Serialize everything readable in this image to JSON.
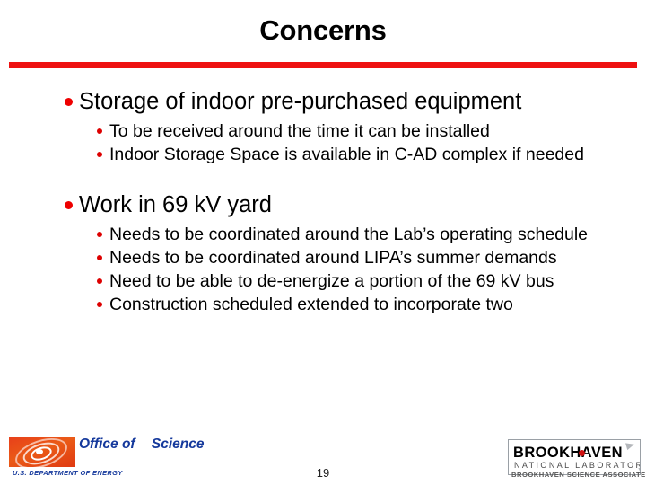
{
  "slide": {
    "title": "Concerns",
    "accent_color": "#ee1111",
    "bullet_color": "#ee0000",
    "page_number": "19"
  },
  "content": {
    "groups": [
      {
        "heading": "Storage of indoor pre-purchased equipment",
        "subs": [
          "To be received around the time it can be installed",
          "Indoor Storage Space is available in C-AD complex if needed"
        ]
      },
      {
        "heading": "Work in 69 kV yard",
        "subs": [
          "Needs to be coordinated around the Lab’s operating schedule",
          "Needs to be coordinated around LIPA’s summer demands",
          "Need to be able to de-energize a portion of the 69 kV bus",
          "Construction scheduled extended to incorporate two"
        ]
      }
    ]
  },
  "footer": {
    "doe_logo": {
      "line1": "Office",
      "line2": "of",
      "line3": "Science",
      "department": "U.S. DEPARTMENT OF ENERGY",
      "text_color": "#15399c",
      "swirl_color": "#e8401a"
    },
    "bnl_logo": {
      "name": "BROOKHAVEN",
      "subtitle": "NATIONAL LABORATORY",
      "associates": "BROOKHAVEN SCIENCE ASSOCIATES",
      "dot_color": "#d01010"
    }
  }
}
